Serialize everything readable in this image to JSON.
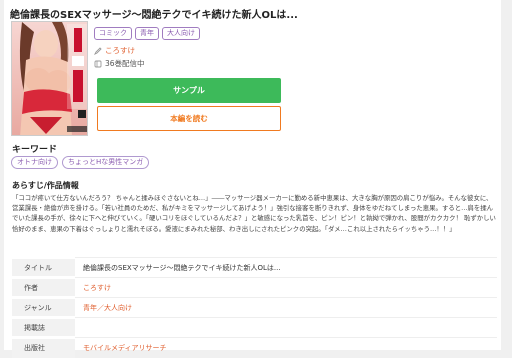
{
  "book": {
    "title": "絶倫課長のSEXマッサージ～悶絶テクでイキ続けた新人OLは...",
    "tags": [
      "コミック",
      "青年",
      "大人向け"
    ],
    "author": "ころすけ",
    "delivery_count": "36巻配信中",
    "cover_alt_text": "絶倫課長のSEXマッサージ"
  },
  "buttons": {
    "sample": "サンプル",
    "read_full": "本編を読む"
  },
  "keywords": {
    "heading": "キーワード",
    "items": [
      "オトナ向け",
      "ちょっとHな男性マンガ"
    ]
  },
  "synopsis": {
    "heading": "あらすじ/作品情報",
    "text": "「ココが疼いて仕方ないんだろう？ ちゃんと揉みほぐさないとね…」――マッサージ器メーカーに勤める新中恵果は、大きな胸が原因の肩こりが悩み。そんな彼女に、営業課長・絶倫が声を掛ける。「若い社員のためだ、私がキミをマッサージしてあげよう！」強引な接客を断りきれず、身体をゆだねてしまった恵果。すると…肩を揉んでいた課長の手が、徐々に下へと伸びていく。「硬いコリをほぐしているんだよ？」と敏感になった乳首を、ピン！ピン！と執拗で弾かれ、股間がカクカク！ 恥ずかしい恰好のまま、恵果の下着はぐっしょりと濡れそぼる。愛液にまみれた秘部、わき出しにされたピンクの突起。「ダメ…これ以上されたらイッちゃう…！！」"
  },
  "info_table": [
    {
      "label": "タイトル",
      "value": "絶倫課長のSEXマッサージ～悶絶テクでイキ続けた新人OLは...",
      "link": false
    },
    {
      "label": "作者",
      "value": "ころすけ",
      "link": true
    },
    {
      "label": "ジャンル",
      "value": "青年／大人向け",
      "link": true
    },
    {
      "label": "掲載誌",
      "value": "",
      "link": false
    },
    {
      "label": "出版社",
      "value": "モバイルメディアリサーチ",
      "link": true
    }
  ],
  "colors": {
    "accent_green": "#3dba5a",
    "accent_orange": "#f07a20",
    "tag_purple": "#8a5cb0",
    "link_orange": "#e06030"
  }
}
